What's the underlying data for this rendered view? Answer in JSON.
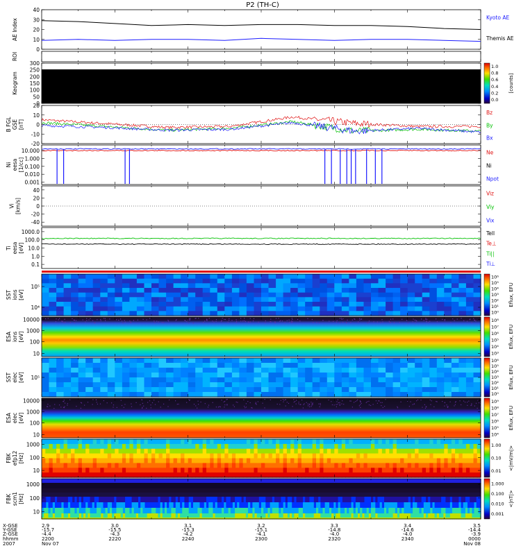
{
  "title": "P2 (TH-C)",
  "colors": {
    "blue": "#1a1aff",
    "green": "#00c000",
    "red": "#e01010",
    "black": "#000000"
  },
  "chart_data": [
    {
      "type": "line",
      "key": "ae",
      "ylabel": "AE Index",
      "ylim": [
        0,
        40
      ],
      "ticks": [
        "0",
        "10",
        "20",
        "30",
        "40"
      ],
      "labels": [
        "Kyoto AE",
        "Themis AE"
      ],
      "series": [
        {
          "name": "Kyoto AE",
          "color": "#000000",
          "x": [
            2200,
            2210,
            2220,
            2230,
            2240,
            2250,
            2300,
            2310,
            2320,
            2330,
            2340,
            2350,
            2400
          ],
          "values": [
            29,
            28,
            26,
            24,
            25,
            24,
            25,
            25,
            24,
            24,
            23,
            21,
            20
          ]
        },
        {
          "name": "Themis AE",
          "color": "#1a1aff",
          "x": [
            2200,
            2210,
            2220,
            2230,
            2240,
            2250,
            2300,
            2310,
            2320,
            2330,
            2340,
            2350,
            2400
          ],
          "values": [
            9,
            10,
            9,
            10,
            10,
            9,
            11,
            10,
            9,
            10,
            10,
            9,
            8
          ]
        }
      ]
    },
    {
      "type": "strip",
      "key": "roi",
      "ylabel": "ROI"
    },
    {
      "type": "heatmap",
      "key": "keogram",
      "ylabel": "Keogram",
      "ylim": [
        0,
        300
      ],
      "ticks": [
        "0",
        "50",
        "100",
        "150",
        "200",
        "250",
        "300"
      ],
      "colorbar": {
        "ticks": [
          "0.0",
          "0.2",
          "0.4",
          "0.6",
          "0.8",
          "1.0"
        ],
        "unit": "[counts]"
      }
    },
    {
      "type": "line",
      "key": "bfgl",
      "ylabel": "B FGL",
      "ylabel2": "GSE",
      "unit": "[nT]",
      "ylim": [
        -20,
        20
      ],
      "ticks": [
        "-20",
        "-10",
        "0",
        "10",
        "20"
      ],
      "labels": [
        "Bz",
        "By",
        "Bx"
      ],
      "series": [
        {
          "name": "Bz",
          "color": "#e01010",
          "x": [
            2200,
            2220,
            2240,
            2300,
            2320,
            2330,
            2340,
            2400
          ],
          "values": [
            5,
            1,
            -3,
            -2,
            8,
            1,
            -2,
            -2
          ]
        },
        {
          "name": "By",
          "color": "#00c000",
          "x": [
            2200,
            2220,
            2240,
            2300,
            2320,
            2330,
            2340,
            2400
          ],
          "values": [
            2,
            -2,
            -6,
            -4,
            3,
            -7,
            -5,
            -7
          ]
        },
        {
          "name": "Bx",
          "color": "#1a1aff",
          "x": [
            2200,
            2220,
            2240,
            2300,
            2320,
            2330,
            2340,
            2400
          ],
          "values": [
            -1,
            -3,
            -6,
            -5,
            2,
            -7,
            -4,
            -8
          ]
        }
      ]
    },
    {
      "type": "line",
      "key": "ni",
      "ylabel": "Ni",
      "ylabel2": "eesa",
      "unit": "[1/cc]",
      "scale": "log",
      "ticks": [
        "0.001",
        "0.010",
        "0.100",
        "1.000",
        "10.000"
      ],
      "labels": [
        "Ne",
        "Ni",
        "Npot"
      ],
      "series": [
        {
          "name": "Ne",
          "color": "#e01010",
          "values": [
            10.0,
            10.0
          ]
        },
        {
          "name": "Ni",
          "color": "#000000",
          "values": [
            6.0,
            6.0
          ]
        },
        {
          "name": "Npot",
          "color": "#1a1aff",
          "values": [
            16.0,
            16.0
          ]
        }
      ]
    },
    {
      "type": "line",
      "key": "vi",
      "ylabel": "Vi",
      "unit": "[km/s]",
      "ylim": [
        -50,
        50
      ],
      "ticks": [
        "-40",
        "-20",
        "0",
        "20",
        "40"
      ],
      "labels": [
        "Viz",
        "Viy",
        "Vix"
      ]
    },
    {
      "type": "line",
      "key": "ti",
      "ylabel": "Ti",
      "ylabel2": "eesa",
      "unit": "[eV]",
      "scale": "log",
      "ticks": [
        "0.1",
        "1.0",
        "10.0",
        "100.0",
        "1000.0"
      ],
      "labels": [
        "Tell",
        "Te⊥",
        "Ti||",
        "Ti⊥"
      ],
      "series": [
        {
          "name": "Te",
          "color": "#00c000",
          "values": [
            150,
            150
          ]
        },
        {
          "name": "Ti",
          "color": "#000000",
          "values": [
            30,
            30
          ]
        }
      ]
    },
    {
      "type": "strip",
      "key": "bar"
    },
    {
      "type": "heatmap",
      "key": "sst_i",
      "ylabel": "SST",
      "ylabel2": "ions",
      "unit": "[eV]",
      "ticks": [
        "10⁴",
        "10⁵"
      ],
      "colorbar": {
        "ticks": [
          "10⁰",
          "10¹",
          "10²",
          "10³",
          "10⁴",
          "10⁵",
          "10⁶"
        ],
        "unit": "Eflux, EFU"
      }
    },
    {
      "type": "heatmap",
      "key": "esa_i",
      "ylabel": "ESA",
      "ylabel2": "ions",
      "unit": "[eV]",
      "ticks": [
        "10",
        "100",
        "1000",
        "10000"
      ],
      "colorbar": {
        "ticks": [
          "10³",
          "10⁴",
          "10⁵",
          "10⁶",
          "10⁷",
          "10⁸"
        ],
        "unit": "Eflux, EFU"
      }
    },
    {
      "type": "heatmap",
      "key": "sst_e",
      "ylabel": "SST",
      "ylabel2": "elec",
      "unit": "[eV]",
      "ticks": [
        "10⁵"
      ],
      "colorbar": {
        "ticks": [
          "10⁰",
          "10¹",
          "10²",
          "10³",
          "10⁴",
          "10⁵",
          "10⁶"
        ],
        "unit": "Eflux, EFU"
      }
    },
    {
      "type": "heatmap",
      "key": "esa_e",
      "ylabel": "ESA",
      "ylabel2": "elec",
      "unit": "[eV]",
      "ticks": [
        "10",
        "100",
        "1000",
        "10000"
      ],
      "colorbar": {
        "ticks": [
          "10⁴",
          "10⁵",
          "10⁶",
          "10⁷",
          "10⁸",
          "10⁹"
        ],
        "unit": "Eflux, EFU"
      }
    },
    {
      "type": "heatmap",
      "key": "fbk_e",
      "ylabel": "FBK",
      "ylabel2": "efp12",
      "unit": "[Hz]",
      "ticks": [
        "10",
        "100",
        "1000"
      ],
      "colorbar": {
        "ticks": [
          "0.01",
          "0.10",
          "1.00"
        ],
        "unit": "<|mV/m|>"
      }
    },
    {
      "type": "heatmap",
      "key": "fbk_b",
      "ylabel": "FBK",
      "ylabel2": "scm1",
      "unit": "[Hz]",
      "ticks": [
        "10",
        "100",
        "1000"
      ],
      "colorbar": {
        "ticks": [
          "0.001",
          "0.010",
          "0.100",
          "1.000"
        ],
        "unit": "<|nT|>"
      }
    }
  ],
  "xaxis": {
    "row_labels": [
      "X-GSE",
      "Y-GSE",
      "Z-GSE",
      "hhmm",
      "2007"
    ],
    "columns": [
      {
        "x": "2.9",
        "y": "-15.7",
        "z": "-4.4",
        "t": "2200",
        "d": "Nov 07"
      },
      {
        "x": "3.0",
        "y": "-15.5",
        "z": "-4.3",
        "t": "2220",
        "d": ""
      },
      {
        "x": "3.1",
        "y": "-15.3",
        "z": "-4.2",
        "t": "2240",
        "d": ""
      },
      {
        "x": "3.2",
        "y": "-15.1",
        "z": "-4.1",
        "t": "2300",
        "d": ""
      },
      {
        "x": "3.3",
        "y": "-14.8",
        "z": "-4.0",
        "t": "2320",
        "d": ""
      },
      {
        "x": "3.4",
        "y": "-14.6",
        "z": "-4.0",
        "t": "2340",
        "d": ""
      },
      {
        "x": "3.5",
        "y": "-14.4",
        "z": "-3.9",
        "t": "0000",
        "d": "Nov 08"
      }
    ]
  }
}
